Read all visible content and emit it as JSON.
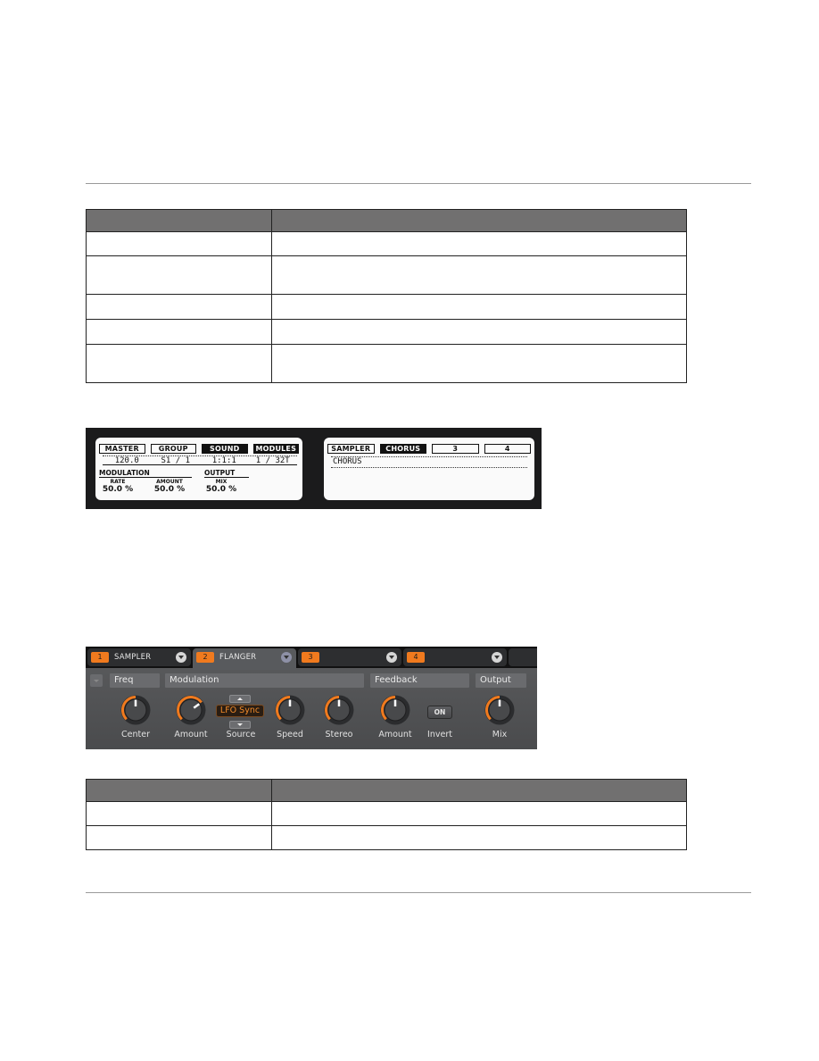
{
  "document": {
    "table1": {
      "headers": [
        "",
        ""
      ],
      "rows": [
        [
          "",
          ""
        ],
        [
          "",
          ""
        ],
        [
          "",
          ""
        ],
        [
          "",
          ""
        ],
        [
          "",
          ""
        ]
      ]
    },
    "table2": {
      "headers": [
        "",
        ""
      ],
      "rows": [
        [
          "",
          ""
        ],
        [
          "",
          ""
        ]
      ]
    }
  },
  "hardware_display": {
    "left": {
      "tabs": [
        {
          "label": "MASTER",
          "active": false
        },
        {
          "label": "GROUP",
          "active": false
        },
        {
          "label": "SOUND",
          "active": true
        },
        {
          "label": "MODULES",
          "active": true
        }
      ],
      "values": [
        "120.0",
        "S1 / 1",
        "1:1:1",
        "1 / 32T"
      ],
      "sections": [
        {
          "title": "MODULATION",
          "params": [
            {
              "label": "RATE",
              "value": "50.0 %"
            },
            {
              "label": "AMOUNT",
              "value": "50.0 %"
            }
          ]
        },
        {
          "title": "OUTPUT",
          "params": [
            {
              "label": "MIX",
              "value": "50.0 %"
            }
          ]
        }
      ]
    },
    "right": {
      "tabs": [
        {
          "label": "SAMPLER",
          "active": false
        },
        {
          "label": "CHORUS",
          "active": true
        },
        {
          "label": "3",
          "active": false
        },
        {
          "label": "4",
          "active": false
        }
      ],
      "module_name": "CHORUS"
    }
  },
  "plugin_panel": {
    "slots": [
      {
        "number": "1",
        "name": "SAMPLER",
        "active": false
      },
      {
        "number": "2",
        "name": "FLANGER",
        "active": true
      },
      {
        "number": "3",
        "name": "",
        "active": false
      },
      {
        "number": "4",
        "name": "",
        "active": false
      }
    ],
    "sections": {
      "freq": "Freq",
      "modulation": "Modulation",
      "feedback": "Feedback",
      "output": "Output"
    },
    "controls": {
      "center": {
        "label": "Center",
        "value": 0.5
      },
      "mod_amount": {
        "label": "Amount",
        "value": 0.7
      },
      "source": {
        "label": "Source",
        "value": "LFO Sync"
      },
      "speed": {
        "label": "Speed",
        "value": 0.5
      },
      "stereo": {
        "label": "Stereo",
        "value": 0.5
      },
      "fb_amount": {
        "label": "Amount",
        "value": 0.5
      },
      "invert": {
        "label": "Invert",
        "button": "ON"
      },
      "mix": {
        "label": "Mix",
        "value": 0.5
      }
    },
    "colors": {
      "accent": "#f07a1e",
      "panel": "#535456"
    }
  }
}
